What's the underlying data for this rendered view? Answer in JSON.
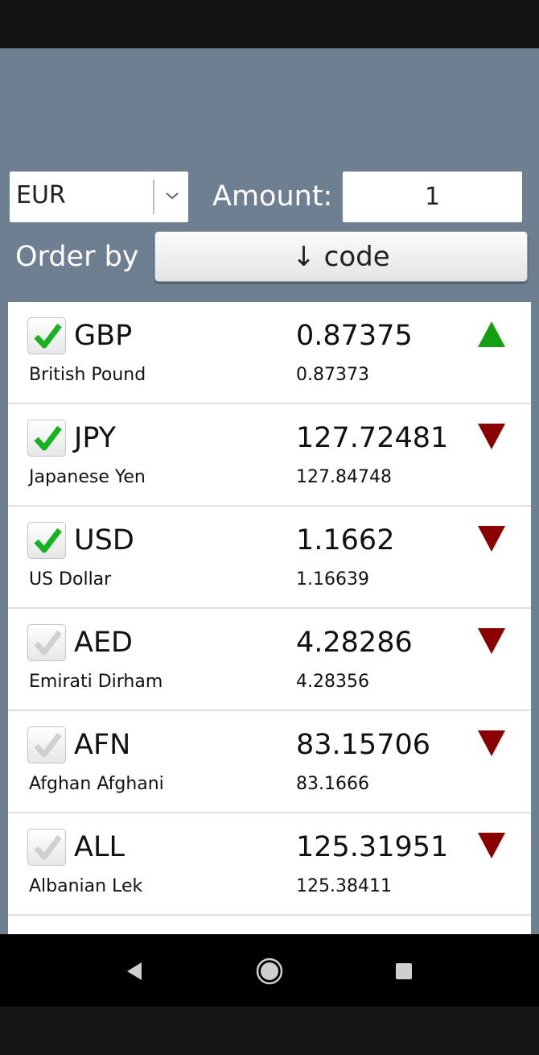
{
  "header": {
    "currency_select": {
      "selected": "EUR"
    },
    "amount_label": "Amount:",
    "amount_value": "1",
    "order_label": "Order by",
    "order_button_label": "↓ code"
  },
  "rates": [
    {
      "code": "GBP",
      "name": "British Pound",
      "rate": "0.87375",
      "previous": "0.87373",
      "checked": true,
      "trend": "up"
    },
    {
      "code": "JPY",
      "name": "Japanese Yen",
      "rate": "127.72481",
      "previous": "127.84748",
      "checked": true,
      "trend": "down"
    },
    {
      "code": "USD",
      "name": "US Dollar",
      "rate": "1.1662",
      "previous": "1.16639",
      "checked": true,
      "trend": "down"
    },
    {
      "code": "AED",
      "name": "Emirati Dirham",
      "rate": "4.28286",
      "previous": "4.28356",
      "checked": false,
      "trend": "down"
    },
    {
      "code": "AFN",
      "name": "Afghan Afghani",
      "rate": "83.15706",
      "previous": "83.1666",
      "checked": false,
      "trend": "down"
    },
    {
      "code": "ALL",
      "name": "Albanian Lek",
      "rate": "125.31951",
      "previous": "125.38411",
      "checked": false,
      "trend": "down"
    }
  ],
  "colors": {
    "background": "#6e7f92",
    "check_on": "#17b21f",
    "check_off": "#d0d0d0",
    "trend_up": "#12a012",
    "trend_down": "#8a0000"
  },
  "icons": {
    "select_arrow": "chevron-down-icon",
    "check": "checkmark-icon",
    "trend_up": "triangle-up-icon",
    "trend_down": "triangle-down-icon",
    "nav_back": "back-triangle-icon",
    "nav_home": "home-circle-icon",
    "nav_recents": "recents-square-icon"
  }
}
